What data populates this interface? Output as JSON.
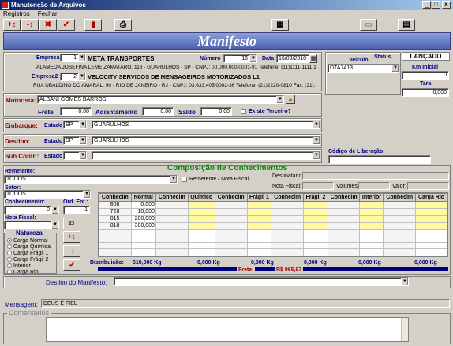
{
  "window": {
    "title": "Manutenção de Arquivos"
  },
  "menu": [
    "Registros",
    "Fechar"
  ],
  "banner": "Manifesto",
  "header": {
    "empresa_label": "Empresa",
    "empresa_num": "1",
    "empresa_name": "META TRANSPORTES",
    "empresa_addr": "ALAMEDA JOSEFINA LEME ZAMATARO, 118 - GUARULHOS - SP - CNPJ: 00.000.000/0001-91 Telefone: (11)1111-1111 1",
    "empresa2_label": "Empresa2",
    "empresa2_num": "2",
    "empresa2_name": "VELOCITY SERVICOS DE MENSAGEIROS MOTORIZADOS L1",
    "empresa2_addr": "RUA UBALDINO DO AMARAL, 90 - RIO DE JANEIRO - RJ - CNPJ: 03.633.405/0002-36 Telefone: (21)2220-0810 Fax: (21).",
    "numero_label": "Número",
    "numero": "16",
    "data_label": "Data",
    "data": "16/08/2010",
    "veiculo_label": "Veículo",
    "veiculo": "DTA7413",
    "status_label": "Status",
    "status": "LANÇADO",
    "km_label": "Km Inicial",
    "km": "0",
    "tara_label": "Tara",
    "tara": "0,000"
  },
  "motorista": {
    "label": "Motorista:",
    "value": "ALBANI GOMES BARROS",
    "frete_label": "Frete",
    "frete": "0,00",
    "adiant_label": "Adiantamento",
    "adiant": "0,00",
    "saldo_label": "Saldo",
    "saldo": "0,00",
    "terceiro_label": "Existe Terceiro?"
  },
  "embarque": {
    "label": "Embarque:",
    "estado_label": "Estado",
    "estado": "SP",
    "cidade": "GUARULHOS"
  },
  "destino": {
    "label": "Destino:",
    "estado_label": "Estado",
    "estado": "SP",
    "cidade": "GUARULHOS"
  },
  "subcontr": {
    "label": "Sub Contr.:",
    "estado_label": "Estado",
    "estado": "",
    "cidade": ""
  },
  "liberacao_label": "Código de Liberação:",
  "composicao": {
    "title": "Composição de Conhecimentos",
    "remetente_label": "Remetente:",
    "remetente": "TODOS",
    "remnota_label": "Remetente / Nota Fiscal",
    "destinatario_label": "Destinatário:",
    "setor_label": "Setor:",
    "setor": "TODOS",
    "nf_label": "Nota Fiscal:",
    "volumes_label": "Volumes:",
    "valor_label": "Valor:",
    "conhecimento_label": "Conhecimento:",
    "conhecimento": "0",
    "ordent_label": "Ord. Ent.:",
    "ordent": "1",
    "notafiscal_label": "Nota Fiscal:"
  },
  "natureza": {
    "title": "Natureza",
    "options": [
      "Carga Normal",
      "Carga Química",
      "Carga Frágil 1",
      "Carga Frágil 2",
      "Interior",
      "Carga Rio"
    ],
    "selected": 0
  },
  "grid": {
    "headers": [
      "Conhecim",
      "Normal",
      "Conhecim",
      "Químico",
      "Conhecim",
      "Frágil 1",
      "Conhecim",
      "Frágil 2",
      "Conhecim",
      "Interior",
      "Conhecim",
      "Carga Rio"
    ],
    "rows": [
      [
        "808",
        "0,000"
      ],
      [
        "728",
        "10,000"
      ],
      [
        "815",
        "200,000"
      ],
      [
        "818",
        "300,000"
      ]
    ]
  },
  "distribuicao": {
    "label": "Distribuição:",
    "values": [
      "510,000 Kg",
      "0,000 Kg",
      "0,000 Kg",
      "0,000 Kg",
      "0,000 Kg",
      "0,000 Kg"
    ],
    "frete_label": "Frete:",
    "frete": "R$ 965,97"
  },
  "destino_manifesto_label": "Destino do Manifesto:",
  "mensagem_label": "Mensagem:",
  "mensagem": "DEUS É FIEL",
  "comentarios_label": "Comentários"
}
